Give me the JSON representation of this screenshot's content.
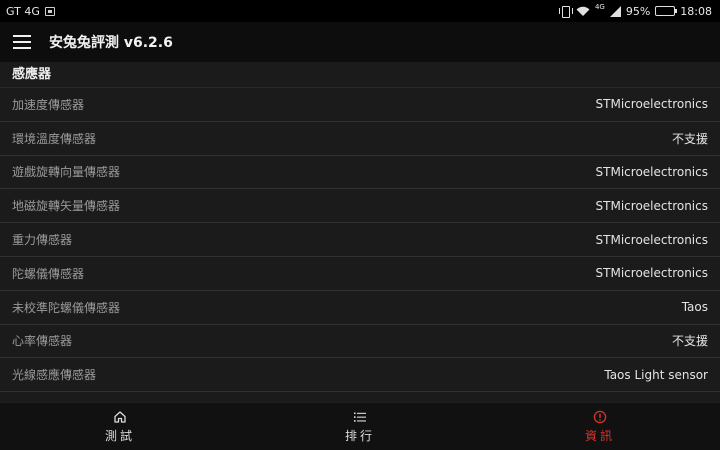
{
  "status_bar": {
    "carrier": "GT 4G",
    "network_badge": "4G",
    "battery_percent": "95%",
    "battery_level": 0.95,
    "time": "18:08"
  },
  "app_bar": {
    "title": "安兔兔評測 v6.2.6"
  },
  "section": {
    "title": "感應器"
  },
  "sensors": [
    {
      "label": "加速度傳感器",
      "value": "STMicroelectronics"
    },
    {
      "label": "環境溫度傳感器",
      "value": "不支援"
    },
    {
      "label": "遊戲旋轉向量傳感器",
      "value": "STMicroelectronics"
    },
    {
      "label": "地磁旋轉矢量傳感器",
      "value": "STMicroelectronics"
    },
    {
      "label": "重力傳感器",
      "value": "STMicroelectronics"
    },
    {
      "label": "陀螺儀傳感器",
      "value": "STMicroelectronics"
    },
    {
      "label": "未校準陀螺儀傳感器",
      "value": "Taos"
    },
    {
      "label": "心率傳感器",
      "value": "不支援"
    },
    {
      "label": "光線感應傳感器",
      "value": "Taos Light sensor"
    }
  ],
  "bottom_nav": {
    "items": [
      {
        "label": "測試",
        "icon": "home-icon"
      },
      {
        "label": "排行",
        "icon": "list-icon"
      },
      {
        "label": "資訊",
        "icon": "info-icon"
      }
    ],
    "active_index": 2,
    "active_color": "#d9342b"
  }
}
